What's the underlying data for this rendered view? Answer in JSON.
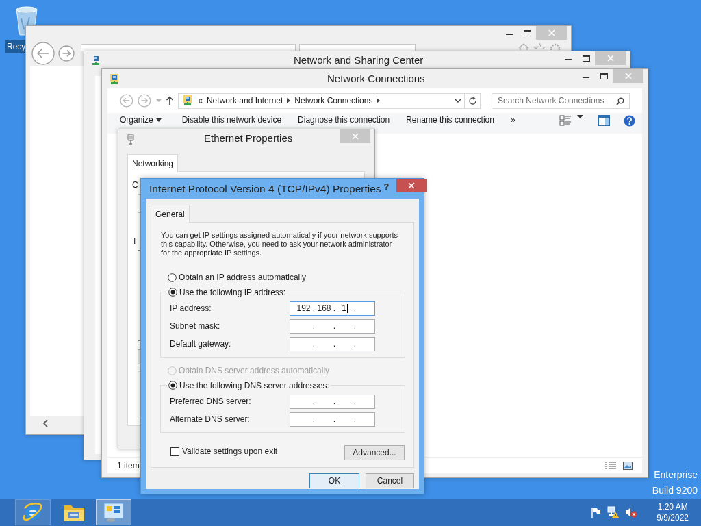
{
  "desktop": {
    "icons": [
      {
        "label": "Recy",
        "selected": true
      }
    ],
    "watermark": [
      "Enterprise",
      "Build 9200"
    ]
  },
  "sharing_center": {
    "title": "Network and Sharing Center"
  },
  "connections": {
    "title": "Network Connections",
    "breadcrumb_lead": "«",
    "breadcrumb": [
      "Network and Internet",
      "Network Connections"
    ],
    "search": {
      "placeholder": "Search Network Connections"
    },
    "commands": [
      {
        "label": "Organize",
        "kind": "menu"
      },
      {
        "label": "Disable this network device",
        "kind": "plain"
      },
      {
        "label": "Diagnose this connection",
        "kind": "plain"
      },
      {
        "label": "Rename this connection",
        "kind": "plain"
      },
      {
        "label": "»",
        "kind": "plain"
      }
    ],
    "status": "1 item"
  },
  "ethernet": {
    "title": "Ethernet Properties",
    "tabs": [
      {
        "label": "Networking",
        "selected": true
      }
    ],
    "labels": [
      "C",
      "T"
    ]
  },
  "ipv4": {
    "title": "Internet Protocol Version 4 (TCP/IPv4) Properties",
    "help": "?",
    "tabs": [
      {
        "label": "General",
        "selected": true
      }
    ],
    "intro": "You can get IP settings assigned automatically if your network supports this capability. Otherwise, you need to ask your network administrator for the appropriate IP settings.",
    "ip_options": [
      {
        "label": "Obtain an IP address automatically",
        "selected": false,
        "disabled": false
      },
      {
        "label": "Use the following IP address:",
        "selected": true,
        "disabled": false
      }
    ],
    "ip_fields": [
      {
        "label": "IP address:",
        "octets": [
          "192",
          "168",
          "1"
        ],
        "dots": [
          ".",
          ".",
          "."
        ],
        "focused": true
      },
      {
        "label": "Subnet mask:",
        "dots": [
          ".",
          ".",
          "."
        ],
        "focused": false
      },
      {
        "label": "Default gateway:",
        "dots": [
          ".",
          ".",
          "."
        ],
        "focused": false
      }
    ],
    "dns_options": [
      {
        "label": "Obtain DNS server address automatically",
        "selected": false,
        "disabled": true
      },
      {
        "label": "Use the following DNS server addresses:",
        "selected": true,
        "disabled": false
      }
    ],
    "dns_fields": [
      {
        "label": "Preferred DNS server:",
        "dots": [
          ".",
          ".",
          "."
        ],
        "focused": false
      },
      {
        "label": "Alternate DNS server:",
        "dots": [
          ".",
          ".",
          "."
        ],
        "focused": false
      }
    ],
    "validate": {
      "label": "Validate settings upon exit",
      "checked": false
    },
    "buttons": [
      {
        "label": "Advanced...",
        "kind": "advanced"
      },
      {
        "label": "OK",
        "kind": "default"
      },
      {
        "label": "Cancel",
        "kind": "cancel"
      }
    ]
  },
  "taskbar": {
    "apps": [
      {
        "kind": "browser",
        "running": true,
        "selected": false
      },
      {
        "kind": "folder",
        "running": false,
        "selected": false
      },
      {
        "kind": "control-panel",
        "running": true,
        "selected": true
      }
    ],
    "tray": [
      {
        "kind": "flag"
      },
      {
        "kind": "network-warning"
      },
      {
        "kind": "speaker-muted"
      }
    ],
    "clock": {
      "time": "1:20 AM",
      "date": "9/9/2022"
    }
  }
}
